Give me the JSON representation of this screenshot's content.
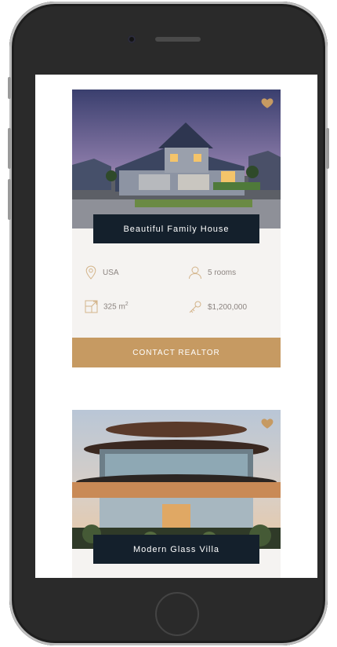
{
  "colors": {
    "accent": "#c69a62",
    "banner": "#14202c",
    "card_bg": "#f5f3f1",
    "text_muted": "#8c8480"
  },
  "listings": [
    {
      "title": "Beautiful Family House",
      "location": "USA",
      "rooms": "5 rooms",
      "area": "325 m",
      "area_sup": "2",
      "price": "$1,200,000",
      "cta": "CONTACT REALTOR"
    },
    {
      "title": "Modern Glass Villa"
    }
  ],
  "icons": [
    "heart-icon",
    "location-pin-icon",
    "user-icon",
    "area-icon",
    "key-icon"
  ]
}
